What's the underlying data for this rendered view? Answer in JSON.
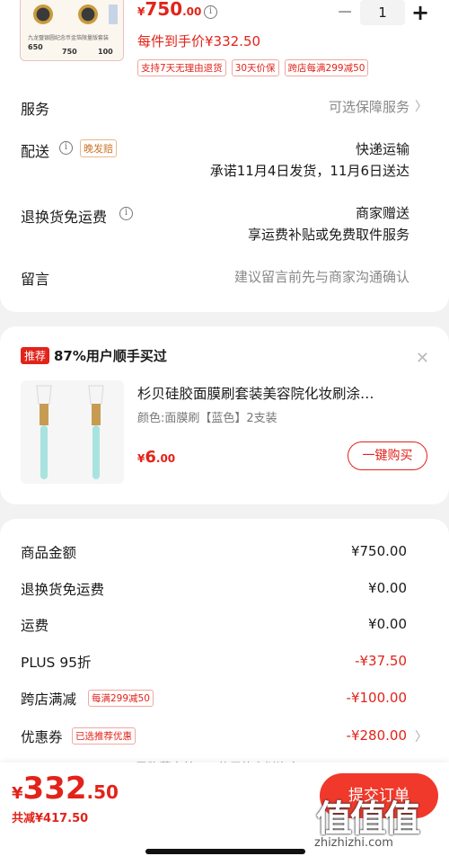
{
  "product": {
    "mini_texts": [
      "九龙璧银圆纪念币金箔限量版套装",
      "龙年纪念",
      "赤盐",
      "7 8 9"
    ],
    "mini_prices": [
      "650",
      "750",
      "100"
    ],
    "price_yen": "¥",
    "price_int": "750",
    "price_dec": ".00",
    "quantity": "1",
    "unit_price": "每件到手价¥332.50",
    "tags": [
      "支持7天无理由退货",
      "30天价保",
      "跨店每满299减50"
    ]
  },
  "service": {
    "label": "服务",
    "value": "可选保障服务"
  },
  "delivery": {
    "label": "配送",
    "tag": "晚发赔",
    "method": "快递运输",
    "promise": "承诺11月4日发货，11月6日送达"
  },
  "returns": {
    "label": "退换货免运费",
    "line1": "商家赠送",
    "line2": "享运费补贴或免费取件服务"
  },
  "message": {
    "label": "留言",
    "placeholder": "建议留言前先与商家沟通确认"
  },
  "recommend": {
    "badge": "推荐",
    "title": "87%用户顺手买过",
    "name": "杉贝硅胶面膜刷套装美容院化妆刷涂…",
    "spec": "颜色:面膜刷【蓝色】2支装",
    "price_yen": "¥",
    "price_int": "6",
    "price_dec": ".00",
    "buy_label": "一键购买"
  },
  "summary": {
    "rows": [
      {
        "label": "商品金额",
        "value": "¥750.00"
      },
      {
        "label": "退换货免运费",
        "value": "¥0.00"
      },
      {
        "label": "运费",
        "value": "¥0.00"
      },
      {
        "label": "PLUS 95折",
        "value": "-¥37.50"
      },
      {
        "label": "跨店满减",
        "value": "-¥100.00",
        "tag": "每满299减50"
      },
      {
        "label": "优惠券",
        "value": "-¥280.00",
        "tag": "已选推荐优惠"
      }
    ],
    "hidden_note": "已隐藏本单不可使用的虚拟资产 ⌄"
  },
  "footer": {
    "total_yen": "¥",
    "total_int": "332",
    "total_dec": ".50",
    "saved": "共减¥417.50",
    "submit_label": "提交订单",
    "watermark": "值值值",
    "watermark_sub": "zhizhizhi.com"
  },
  "colors": {
    "accent": "#e2231a",
    "tag_orange": "#c9752a"
  }
}
